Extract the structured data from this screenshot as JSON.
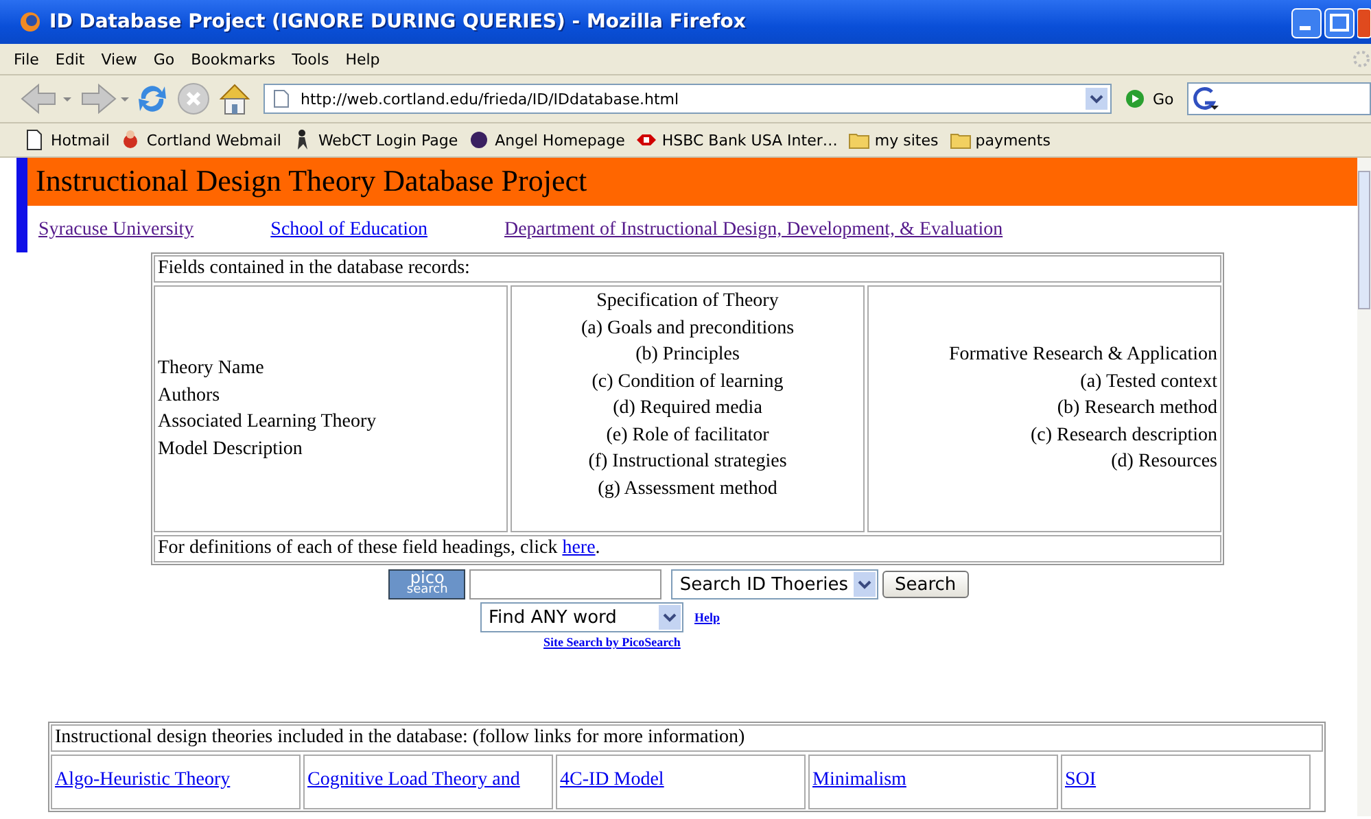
{
  "window": {
    "title": "ID Database Project (IGNORE DURING QUERIES) - Mozilla Firefox"
  },
  "menu": [
    "File",
    "Edit",
    "View",
    "Go",
    "Bookmarks",
    "Tools",
    "Help"
  ],
  "toolbar": {
    "address": "http://web.cortland.edu/frieda/ID/IDdatabase.html",
    "go": "Go"
  },
  "bookmarks": [
    {
      "label": "Hotmail",
      "kind": "page"
    },
    {
      "label": "Cortland Webmail",
      "kind": "mascot"
    },
    {
      "label": "WebCT Login Page",
      "kind": "figure"
    },
    {
      "label": "Angel Homepage",
      "kind": "dot"
    },
    {
      "label": "HSBC Bank USA Inter…",
      "kind": "hexagon"
    },
    {
      "label": "my sites",
      "kind": "folder"
    },
    {
      "label": "payments",
      "kind": "folder"
    }
  ],
  "page": {
    "heading": "Instructional Design Theory Database Project",
    "links": [
      {
        "label": "Syracuse University",
        "visited": true
      },
      {
        "label": "School of Education",
        "visited": false
      },
      {
        "label": "Department of Instructional Design, Development, & Evaluation",
        "visited": true
      }
    ],
    "fields_table": {
      "caption": "Fields contained in the database records:",
      "column_1": [
        "Theory Name",
        "Authors",
        "Associated Learning Theory",
        "Model Description"
      ],
      "column_2": [
        "Specification of Theory",
        "(a) Goals and preconditions",
        "(b) Principles",
        "(c) Condition of learning",
        "(d) Required media",
        "(e) Role of facilitator",
        "(f) Instructional strategies",
        "(g) Assessment method"
      ],
      "column_3": [
        "Formative Research & Application",
        "(a) Tested context",
        "(b) Research method",
        "(c) Research description",
        "(d) Resources"
      ],
      "footer": "For definitions of each of these field headings, click ",
      "footer_link": "here",
      "footer_end": "."
    },
    "search": {
      "logo_top": "pico",
      "logo_bottom": "search",
      "scope": "Search ID Thoeries",
      "button": "Search",
      "mode": "Find ANY word",
      "help": "Help",
      "credit": "Site Search by PicoSearch"
    },
    "theories_table": {
      "caption": "Instructional design theories included in the database: (follow links for more information)",
      "links": [
        "Algo-Heuristic Theory",
        "Cognitive Load Theory and",
        "4C-ID Model",
        "Minimalism",
        "SOI"
      ]
    }
  }
}
